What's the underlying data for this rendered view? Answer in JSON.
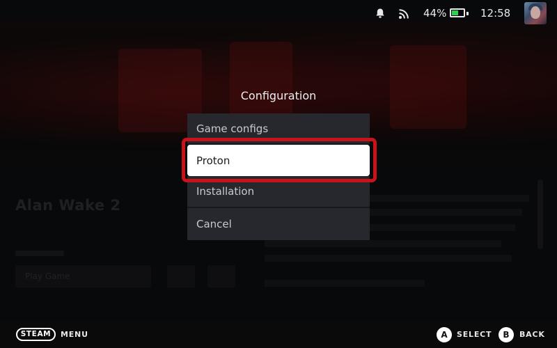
{
  "status_bar": {
    "battery_percent": "44%",
    "battery_level": 0.44,
    "time": "12:58",
    "icons": [
      "notification-bell-icon",
      "wireless-signal-icon",
      "battery-icon"
    ]
  },
  "background": {
    "game_title": "Alan Wake 2",
    "play_button": "Play Game"
  },
  "dialog": {
    "title": "Configuration",
    "items": [
      {
        "label": "Game configs"
      },
      {
        "label": "Proton",
        "selected": true
      },
      {
        "label": "Installation"
      },
      {
        "label": "Cancel"
      }
    ]
  },
  "footer": {
    "steam_label": "STEAM",
    "menu_label": "MENU",
    "a_glyph": "A",
    "select_label": "SELECT",
    "b_glyph": "B",
    "back_label": "BACK"
  },
  "colors": {
    "highlight_ring": "#c8131a",
    "battery_fill": "#2fd14a",
    "menu_bg": "#26282d",
    "selected_bg": "#ffffff"
  }
}
